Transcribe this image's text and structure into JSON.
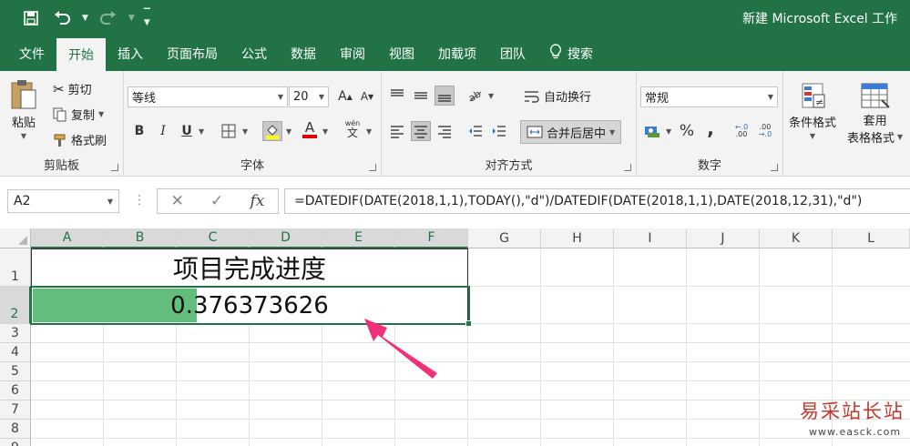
{
  "window": {
    "title": "新建 Microsoft Excel 工作",
    "qat": {
      "save_icon": "save-icon",
      "undo_icon": "undo-icon",
      "redo_icon": "redo-icon",
      "customize_icon": "customize-qat-icon"
    }
  },
  "tabs": [
    {
      "label": "文件",
      "active": false
    },
    {
      "label": "开始",
      "active": true
    },
    {
      "label": "插入",
      "active": false
    },
    {
      "label": "页面布局",
      "active": false
    },
    {
      "label": "公式",
      "active": false
    },
    {
      "label": "数据",
      "active": false
    },
    {
      "label": "审阅",
      "active": false
    },
    {
      "label": "视图",
      "active": false
    },
    {
      "label": "加载项",
      "active": false
    },
    {
      "label": "团队",
      "active": false
    },
    {
      "label": "搜索",
      "active": false
    }
  ],
  "ribbon": {
    "clipboard": {
      "label": "剪贴板",
      "paste": "粘贴",
      "cut": "剪切",
      "copy": "复制",
      "format_painter": "格式刷"
    },
    "font": {
      "label": "字体",
      "font_name": "等线",
      "font_size": "20",
      "bold": "B",
      "italic": "I",
      "underline": "U",
      "phonetic": "wén",
      "font_color_letter": "A"
    },
    "alignment": {
      "label": "对齐方式",
      "wrap_text": "自动换行",
      "merge_center": "合并后居中"
    },
    "number": {
      "label": "数字",
      "format": "常规",
      "percent": "%",
      "comma": ","
    },
    "styles": {
      "conditional_format": "条件格式",
      "table_format_1": "套用",
      "table_format_2": "表格格式"
    }
  },
  "formula_bar": {
    "name_box": "A2",
    "cancel": "✕",
    "enter": "✓",
    "fx": "fx",
    "formula": "=DATEDIF(DATE(2018,1,1),TODAY(),\"d\")/DATEDIF(DATE(2018,1,1),DATE(2018,12,31),\"d\")"
  },
  "sheet": {
    "columns": [
      "A",
      "B",
      "C",
      "D",
      "E",
      "F",
      "G",
      "H",
      "I",
      "J",
      "K",
      "L"
    ],
    "rows": [
      "1",
      "2",
      "3",
      "4",
      "5",
      "6",
      "7",
      "8",
      "9"
    ],
    "selected_row": "2",
    "cell_a1": "项目完成进度",
    "cell_a2": "0.376373626",
    "progress_fraction": 0.376373626,
    "progress_color": "#63be7b",
    "accent_color": "#217346",
    "annotation_color": "#f0307a"
  },
  "watermark": {
    "name": "易采站长站",
    "url": "www.easck.com"
  }
}
